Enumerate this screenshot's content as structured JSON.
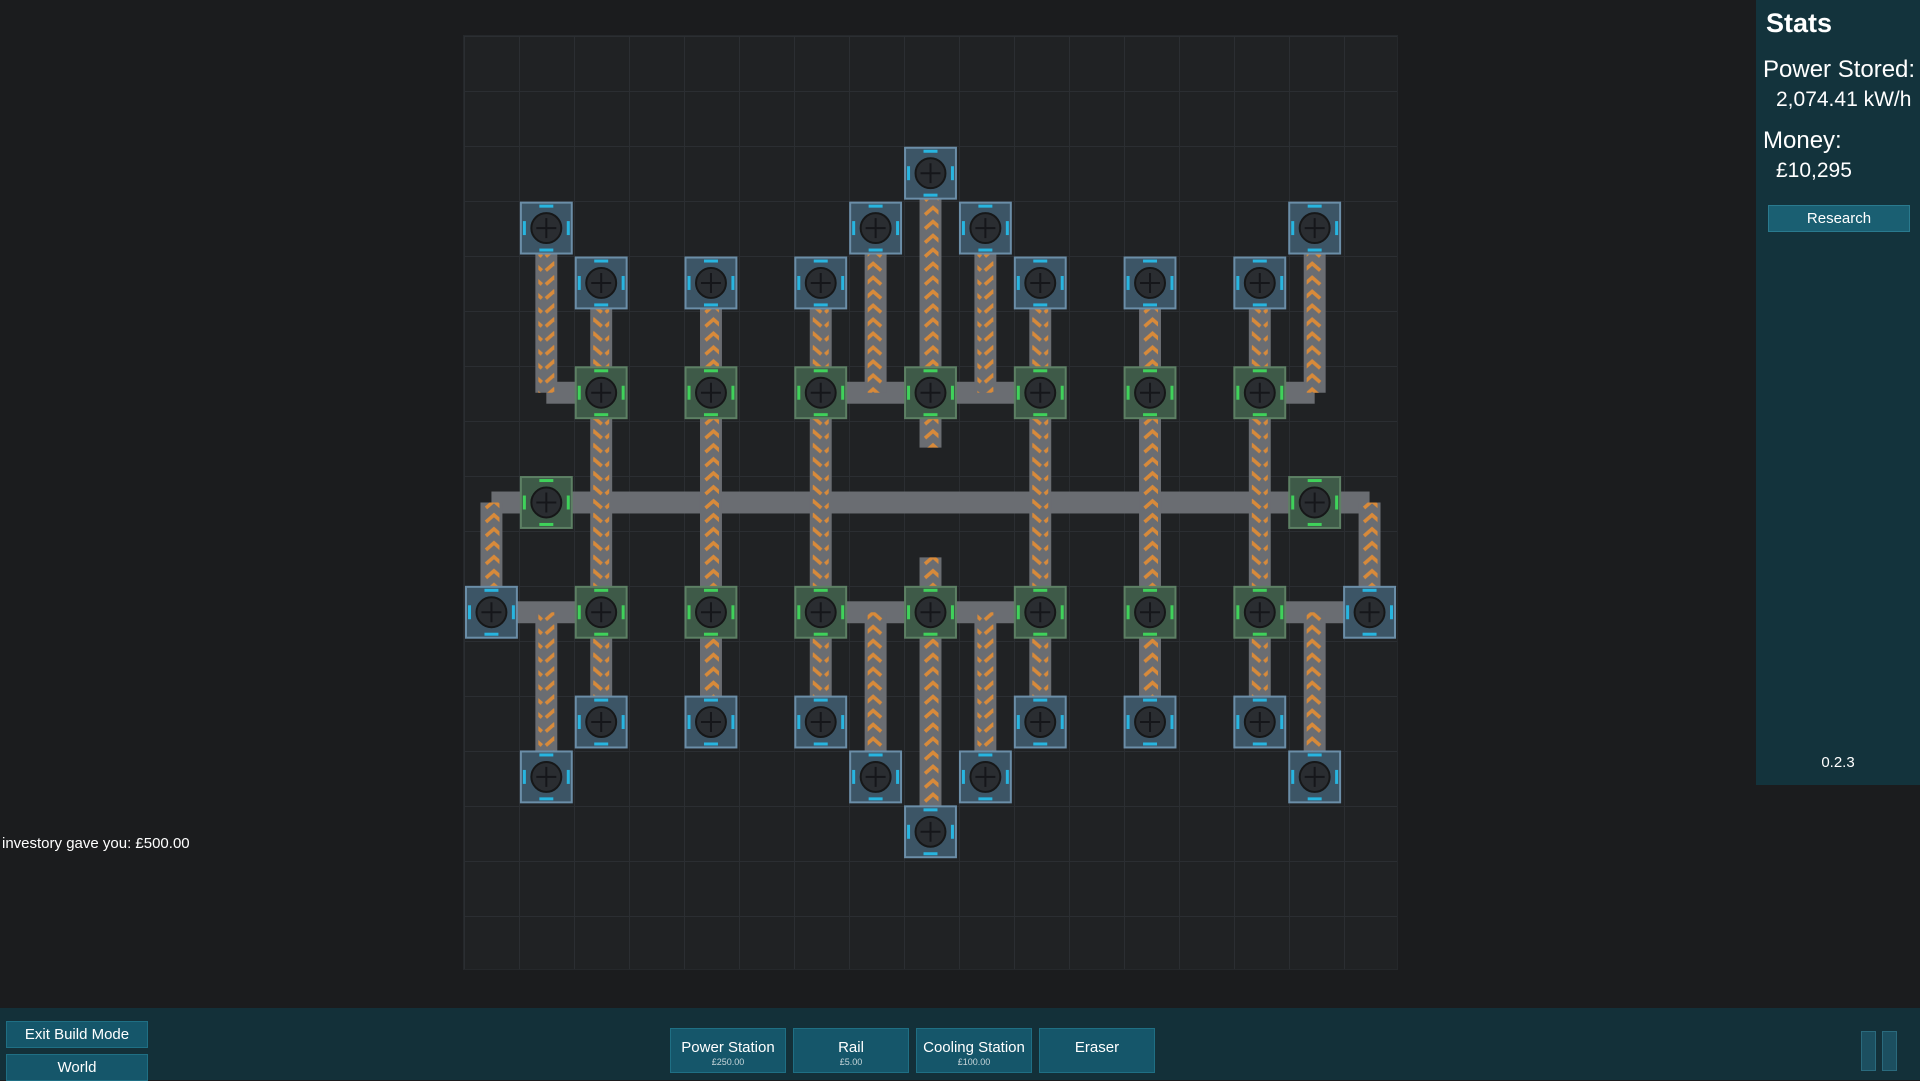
{
  "stats": {
    "title": "Stats",
    "power_label": "Power Stored:",
    "power_value": "2,074.41 kW/h",
    "money_label": "Money:",
    "money_value": "£10,295",
    "research_label": "Research",
    "version": "0.2.3"
  },
  "log_message": "investory gave you: £500.00",
  "bottom": {
    "exit_build_label": "Exit Build Mode",
    "world_label": "World",
    "tools": [
      {
        "name": "Power Station",
        "cost": "£250.00"
      },
      {
        "name": "Rail",
        "cost": "£5.00"
      },
      {
        "name": "Cooling Station",
        "cost": "£100.00"
      },
      {
        "name": "Eraser",
        "cost": ""
      }
    ]
  },
  "icons": {
    "station": "fan-station-icon",
    "pause": "pause-icon"
  },
  "colors": {
    "panel": "#13333c",
    "button": "#15566a",
    "rail_stripe": "#d88a3a",
    "blue_light": "#27b5e0",
    "green_light": "#3fd25a"
  },
  "board": {
    "cols": 17,
    "rows": 17,
    "stations": [
      {
        "c": 8,
        "r": 2,
        "type": "power"
      },
      {
        "c": 1,
        "r": 3,
        "type": "power"
      },
      {
        "c": 7,
        "r": 3,
        "type": "power"
      },
      {
        "c": 9,
        "r": 3,
        "type": "power"
      },
      {
        "c": 15,
        "r": 3,
        "type": "power"
      },
      {
        "c": 2,
        "r": 4,
        "type": "power"
      },
      {
        "c": 4,
        "r": 4,
        "type": "power"
      },
      {
        "c": 6,
        "r": 4,
        "type": "power"
      },
      {
        "c": 10,
        "r": 4,
        "type": "power"
      },
      {
        "c": 12,
        "r": 4,
        "type": "power"
      },
      {
        "c": 14,
        "r": 4,
        "type": "power"
      },
      {
        "c": 2,
        "r": 6,
        "type": "cooling"
      },
      {
        "c": 4,
        "r": 6,
        "type": "cooling"
      },
      {
        "c": 6,
        "r": 6,
        "type": "cooling"
      },
      {
        "c": 8,
        "r": 6,
        "type": "cooling"
      },
      {
        "c": 10,
        "r": 6,
        "type": "cooling"
      },
      {
        "c": 12,
        "r": 6,
        "type": "cooling"
      },
      {
        "c": 14,
        "r": 6,
        "type": "cooling"
      },
      {
        "c": 1,
        "r": 8,
        "type": "cooling"
      },
      {
        "c": 15,
        "r": 8,
        "type": "cooling"
      },
      {
        "c": 0,
        "r": 10,
        "type": "power"
      },
      {
        "c": 2,
        "r": 10,
        "type": "cooling"
      },
      {
        "c": 4,
        "r": 10,
        "type": "cooling"
      },
      {
        "c": 6,
        "r": 10,
        "type": "cooling"
      },
      {
        "c": 8,
        "r": 10,
        "type": "cooling"
      },
      {
        "c": 10,
        "r": 10,
        "type": "cooling"
      },
      {
        "c": 12,
        "r": 10,
        "type": "cooling"
      },
      {
        "c": 14,
        "r": 10,
        "type": "cooling"
      },
      {
        "c": 16,
        "r": 10,
        "type": "power"
      },
      {
        "c": 2,
        "r": 12,
        "type": "power"
      },
      {
        "c": 4,
        "r": 12,
        "type": "power"
      },
      {
        "c": 6,
        "r": 12,
        "type": "power"
      },
      {
        "c": 10,
        "r": 12,
        "type": "power"
      },
      {
        "c": 12,
        "r": 12,
        "type": "power"
      },
      {
        "c": 14,
        "r": 12,
        "type": "power"
      },
      {
        "c": 1,
        "r": 13,
        "type": "power"
      },
      {
        "c": 7,
        "r": 13,
        "type": "power"
      },
      {
        "c": 9,
        "r": 13,
        "type": "power"
      },
      {
        "c": 15,
        "r": 13,
        "type": "power"
      },
      {
        "c": 8,
        "r": 14,
        "type": "power"
      }
    ]
  }
}
